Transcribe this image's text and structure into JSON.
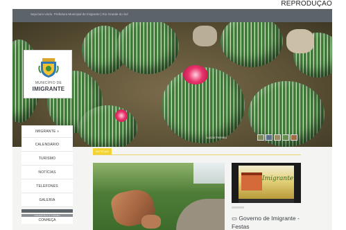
{
  "credit": "REPRODUÇÃO",
  "topbar": {
    "text": "Seja bem-vindo. Prefeitura Municipal de Imigrante | Rio Grande do Sul"
  },
  "logo": {
    "line1": "MUNICÍPIO DE",
    "line2": "IMIGRANTE"
  },
  "hero": {
    "caption": "Lucas Ferreira"
  },
  "sidebar": {
    "items": [
      {
        "label": "IMIGRANTE »"
      },
      {
        "label": "CALENDÁRIO"
      },
      {
        "label": "TURISMO"
      },
      {
        "label": "NOTÍCIAS"
      },
      {
        "label": "TELEFONES"
      },
      {
        "label": "GALERIA"
      }
    ],
    "section_label": "IMIGRANTE E O TURISMO",
    "section_item": "CONHEÇA"
  },
  "content": {
    "section_tag": "NOTÍCIAS",
    "news_title": "Governo de Imigrante - Festas"
  },
  "video": {
    "script_text": "Imigrante"
  },
  "colors": {
    "topbar": "#5c6369",
    "accent": "#f4d32e",
    "page_bg": "#f4f4f2"
  }
}
